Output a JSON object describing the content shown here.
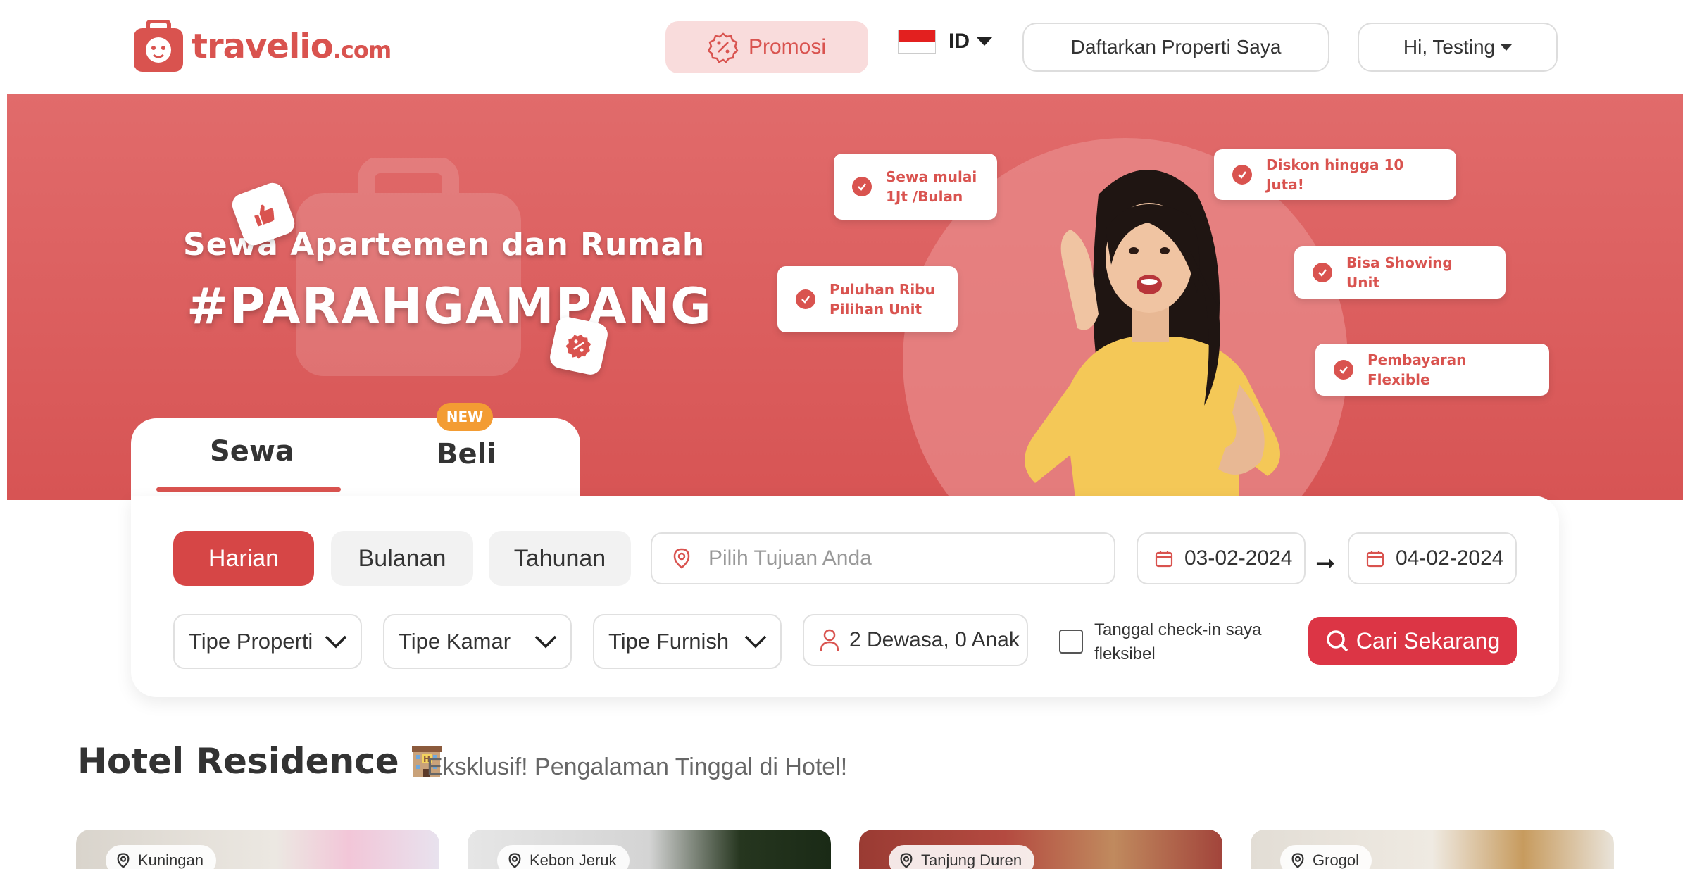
{
  "header": {
    "logo_text": "travelio",
    "logo_suffix": ".com",
    "promo_label": "Promosi",
    "language": "ID",
    "list_property_label": "Daftarkan Properti Saya",
    "user_greeting": "Hi, Testing"
  },
  "hero": {
    "subtitle": "Sewa Apartemen dan Rumah",
    "title": "#PARAHGAMPANG",
    "badges": [
      {
        "line1": "Sewa mulai",
        "line2": "1Jt /Bulan"
      },
      {
        "line1": "Diskon hingga 10 Juta!",
        "line2": ""
      },
      {
        "line1": "Puluhan Ribu",
        "line2": "Pilihan Unit"
      },
      {
        "line1": "Bisa Showing Unit",
        "line2": ""
      },
      {
        "line1": "Pembayaran Flexible",
        "line2": ""
      }
    ]
  },
  "search": {
    "tabs": [
      {
        "label": "Sewa"
      },
      {
        "label": "Beli"
      }
    ],
    "new_badge": "NEW",
    "durations": [
      {
        "label": "Harian"
      },
      {
        "label": "Bulanan"
      },
      {
        "label": "Tahunan"
      }
    ],
    "destination_placeholder": "Pilih Tujuan Anda",
    "checkin": "03-02-2024",
    "checkout": "04-02-2024",
    "property_type": "Tipe Properti",
    "room_type": "Tipe Kamar",
    "furnish_type": "Tipe Furnish",
    "guests": "2 Dewasa, 0 Anak",
    "flexible_label": "Tanggal check-in saya fleksibel",
    "search_button": "Cari Sekarang"
  },
  "section": {
    "title": "Hotel Residence",
    "subtitle": "Eksklusif! Pengalaman Tinggal di Hotel!"
  },
  "cards": [
    {
      "location": "Kuningan"
    },
    {
      "location": "Kebon Jeruk"
    },
    {
      "location": "Tanjung Duren"
    },
    {
      "location": "Grogol"
    }
  ],
  "colors": {
    "brand": "#d9534f",
    "hero": "#dd6161",
    "cta": "#dc3545",
    "new_badge": "#f39c33"
  }
}
